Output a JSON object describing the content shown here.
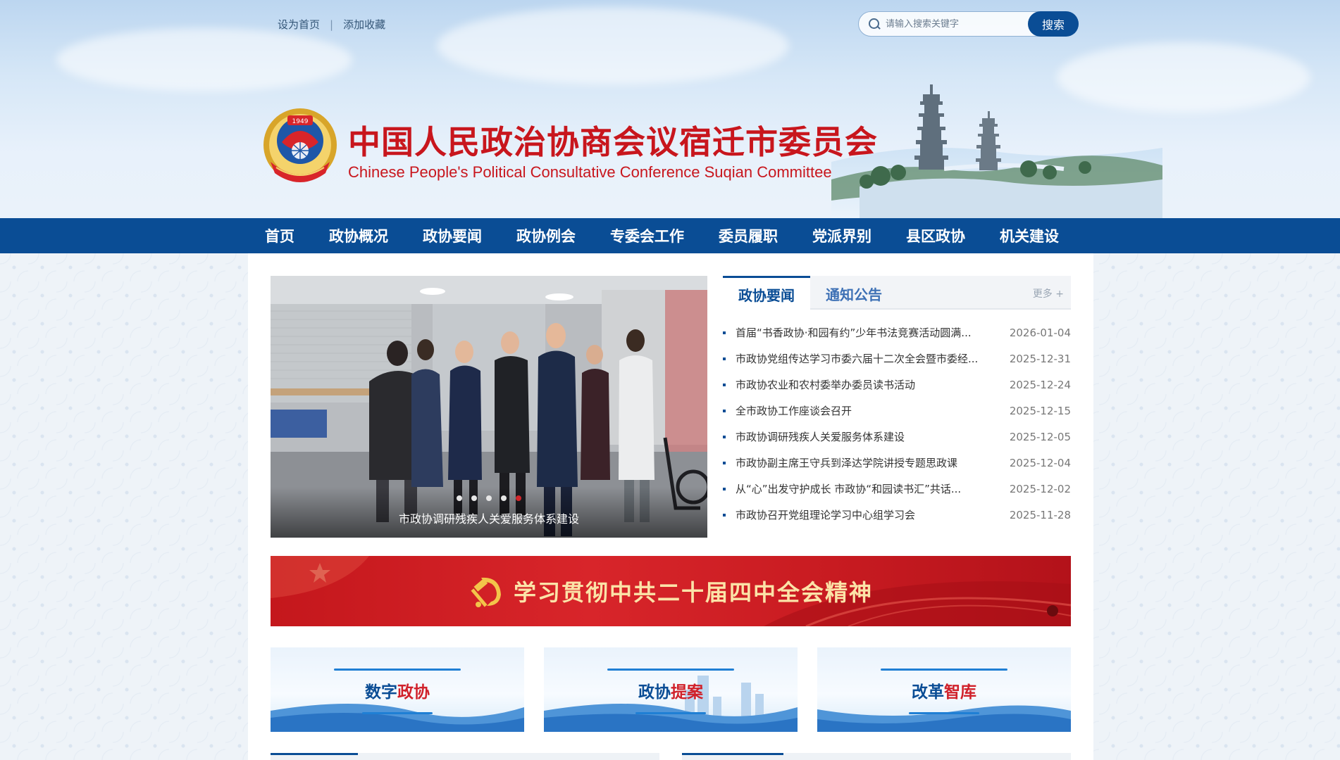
{
  "top_links": {
    "set_home": "设为首页",
    "separator": "|",
    "add_favorite": "添加收藏"
  },
  "search": {
    "placeholder": "请输入搜索关键字",
    "button": "搜索"
  },
  "site": {
    "title": "中国人民政治协商会议宿迁市委员会",
    "subtitle": "Chinese People's Political Consultative Conference Suqian Committee",
    "emblem_year": "1949"
  },
  "nav": [
    "首页",
    "政协概况",
    "政协要闻",
    "政协例会",
    "专委会工作",
    "委员履职",
    "党派界别",
    "县区政协",
    "机关建设"
  ],
  "slider": {
    "caption": "市政协调研残疾人关爱服务体系建设",
    "dot_count": 5,
    "active_dot": 5
  },
  "news": {
    "tabs": [
      "政协要闻",
      "通知公告"
    ],
    "active_tab": 0,
    "more": "更多 +",
    "items": [
      {
        "title": "首届“书香政协·和园有约”少年书法竞赛活动圆满...",
        "date": "2026-01-04"
      },
      {
        "title": "市政协党组传达学习市委六届十二次全会暨市委经...",
        "date": "2025-12-31"
      },
      {
        "title": "市政协农业和农村委举办委员读书活动",
        "date": "2025-12-24"
      },
      {
        "title": "全市政协工作座谈会召开",
        "date": "2025-12-15"
      },
      {
        "title": "市政协调研残疾人关爱服务体系建设",
        "date": "2025-12-05"
      },
      {
        "title": "市政协副主席王守兵到泽达学院讲授专题思政课",
        "date": "2025-12-04"
      },
      {
        "title": "从“心”出发守护成长 市政协“和园读书汇”共话...",
        "date": "2025-12-02"
      },
      {
        "title": "市政协召开党组理论学习中心组学习会",
        "date": "2025-11-28"
      }
    ]
  },
  "banner": {
    "text": "学习贯彻中共二十届四中全会精神"
  },
  "cards": [
    {
      "part1": "数字",
      "part2": "政协"
    },
    {
      "part1": "政协",
      "part2": "提案"
    },
    {
      "part1": "改革",
      "part2": "智库"
    }
  ],
  "colors": {
    "primary": "#0a4d95",
    "accent_red": "#c8161d",
    "banner_red": "#d8252a"
  }
}
